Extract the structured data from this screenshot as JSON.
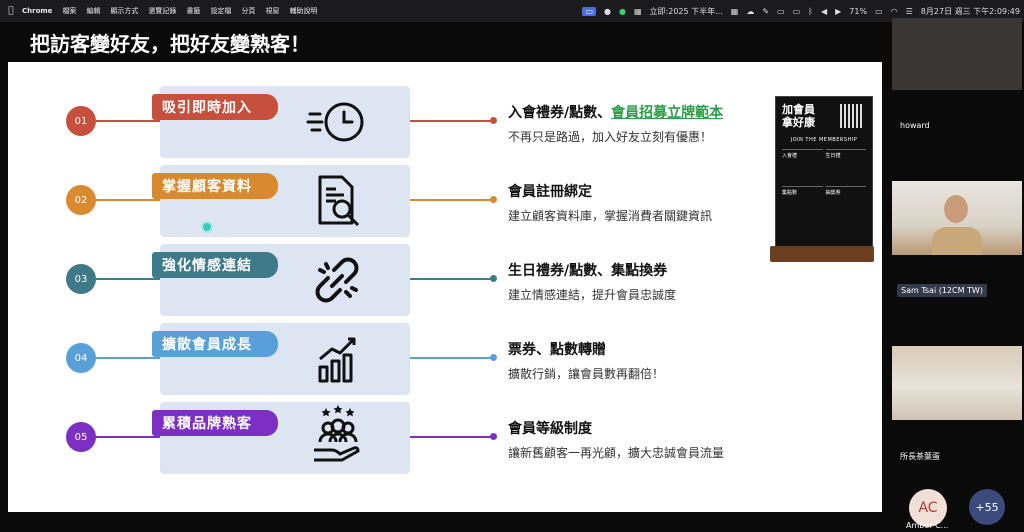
{
  "menubar": {
    "app": "Chrome",
    "menus": [
      "檔案",
      "編輯",
      "顯示方式",
      "瀏覽記錄",
      "書籤",
      "設定檔",
      "分頁",
      "視窗",
      "輔助說明"
    ],
    "calendar_item": "立即:2025 下半年...",
    "battery": "71%",
    "datetime": "8月27日 週三 下午2:09:49"
  },
  "slide": {
    "title": "把訪客變好友，把好友變熟客！",
    "rows": [
      {
        "num": "01",
        "tag": "吸引即時加入",
        "icon": "clock-speed-icon",
        "title_plain": "入會禮券/點數、",
        "title_link": "會員招募立牌範本",
        "desc": "不再只是路過，加入好友立刻有優惠！",
        "color": "#c6503c"
      },
      {
        "num": "02",
        "tag": "掌握顧客資料",
        "icon": "document-search-icon",
        "title_plain": "會員註冊綁定",
        "title_link": "",
        "desc": "建立顧客資料庫，掌握消費者關鍵資訊",
        "color": "#d98a2e"
      },
      {
        "num": "03",
        "tag": "強化情感連結",
        "icon": "broken-link-icon",
        "title_plain": "生日禮券/點數、集點換券",
        "title_link": "",
        "desc": "建立情感連結，提升會員忠誠度",
        "color": "#3f7a88"
      },
      {
        "num": "04",
        "tag": "擴散會員成長",
        "icon": "growth-chart-icon",
        "title_plain": "票券、點數轉贈",
        "title_link": "",
        "desc": "擴散行銷，讓會員數再翻倍！",
        "color": "#5aa0d8"
      },
      {
        "num": "05",
        "tag": "累積品牌熟客",
        "icon": "loyal-customers-icon",
        "title_plain": "會員等級制度",
        "title_link": "",
        "desc": "讓新舊顧客一再光顧，擴大忠誠會員流量",
        "color": "#7d2fc4"
      }
    ],
    "stand": {
      "heading_1": "加會員",
      "heading_2": "拿好康",
      "subtitle": "JOIN THE MEMBERSHIP",
      "cells": [
        "入會禮",
        "生日禮",
        "集點數",
        "抽獎券"
      ]
    }
  },
  "participants": {
    "p1": "howard",
    "p2": "Sam Tsai (12CM TW)",
    "p3": "所長茶葉蛋",
    "avatar_initials": "AC",
    "avatar_name": "Amber C...",
    "more_count": "+55"
  }
}
